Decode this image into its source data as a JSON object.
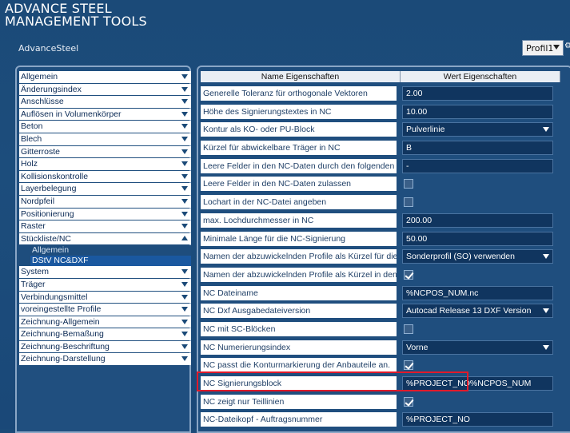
{
  "app": {
    "title_line1": "ADVANCE STEEL",
    "title_line2": "MANAGEMENT TOOLS",
    "module": "AdvanceSteel",
    "profile_select": "Profil1"
  },
  "categories": [
    {
      "label": "Allgemein",
      "state": "collapsed"
    },
    {
      "label": "Änderungsindex",
      "state": "collapsed"
    },
    {
      "label": "Anschlüsse",
      "state": "collapsed"
    },
    {
      "label": "Auflösen in Volumenkörper",
      "state": "collapsed"
    },
    {
      "label": "Beton",
      "state": "collapsed"
    },
    {
      "label": "Blech",
      "state": "collapsed"
    },
    {
      "label": "Gitterroste",
      "state": "collapsed"
    },
    {
      "label": "Holz",
      "state": "collapsed"
    },
    {
      "label": "Kollisionskontrolle",
      "state": "collapsed"
    },
    {
      "label": "Layerbelegung",
      "state": "collapsed"
    },
    {
      "label": "Nordpfeil",
      "state": "collapsed"
    },
    {
      "label": "Positionierung",
      "state": "collapsed"
    },
    {
      "label": "Raster",
      "state": "collapsed"
    },
    {
      "label": "Stückliste/NC",
      "state": "expanded",
      "children": [
        "Allgemein",
        "DStV NC&DXF"
      ],
      "selected_child": "DStV NC&DXF"
    },
    {
      "label": "System",
      "state": "collapsed"
    },
    {
      "label": "Träger",
      "state": "collapsed"
    },
    {
      "label": "Verbindungsmittel",
      "state": "collapsed"
    },
    {
      "label": "voreingestellte Profile",
      "state": "collapsed"
    },
    {
      "label": "Zeichnung-Allgemein",
      "state": "collapsed"
    },
    {
      "label": "Zeichnung-Bemaßung",
      "state": "collapsed"
    },
    {
      "label": "Zeichnung-Beschriftung",
      "state": "collapsed"
    },
    {
      "label": "Zeichnung-Darstellung",
      "state": "collapsed"
    }
  ],
  "grid": {
    "header_name": "Name Eigenschaften",
    "header_value": "Wert Eigenschaften",
    "rows": [
      {
        "name": "Generelle Toleranz für orthogonale Vektoren",
        "type": "text",
        "value": "2.00"
      },
      {
        "name": "Höhe des Signierungstextes in NC",
        "type": "text",
        "value": "10.00"
      },
      {
        "name": "Kontur als KO- oder PU-Block",
        "type": "select",
        "value": "Pulverlinie"
      },
      {
        "name": "Kürzel für abwickelbare Träger in NC",
        "type": "text",
        "value": "B"
      },
      {
        "name": "Leere Felder in den NC-Daten durch den folgenden",
        "type": "text",
        "value": "-"
      },
      {
        "name": "Leere Felder in den NC-Daten zulassen",
        "type": "check",
        "value": false
      },
      {
        "name": "Lochart in der NC-Datei angeben",
        "type": "check",
        "value": false
      },
      {
        "name": "max. Lochdurchmesser in NC",
        "type": "text",
        "value": "200.00"
      },
      {
        "name": "Minimale Länge für die NC-Signierung",
        "type": "text",
        "value": "50.00"
      },
      {
        "name": "Namen der abzuwickelnden Profile als Kürzel für die",
        "type": "select",
        "value": "Sonderprofil (SO) verwenden"
      },
      {
        "name": "Namen der abzuwickelnden Profile als Kürzel in den",
        "type": "check",
        "value": true
      },
      {
        "name": "NC Dateiname",
        "type": "text",
        "value": "%NCPOS_NUM.nc"
      },
      {
        "name": "NC Dxf Ausgabedateiversion",
        "type": "select",
        "value": "Autocad Release 13 DXF Version"
      },
      {
        "name": "NC mit SC-Blöcken",
        "type": "check",
        "value": false
      },
      {
        "name": "NC Numerierungsindex",
        "type": "select",
        "value": "Vorne"
      },
      {
        "name": "NC passt die Konturmarkierung der Anbauteile an.",
        "type": "check",
        "value": true
      },
      {
        "name": "NC Signierungsblock",
        "type": "text",
        "value": "%PROJECT_NO%NCPOS_NUM"
      },
      {
        "name": "NC zeigt nur Teillinien",
        "type": "check",
        "value": true
      },
      {
        "name": "NC-Dateikopf - Auftragsnummer",
        "type": "text",
        "value": "%PROJECT_NO"
      }
    ]
  },
  "colors": {
    "background": "#1b4a78",
    "highlight_border": "#e11a2a"
  }
}
